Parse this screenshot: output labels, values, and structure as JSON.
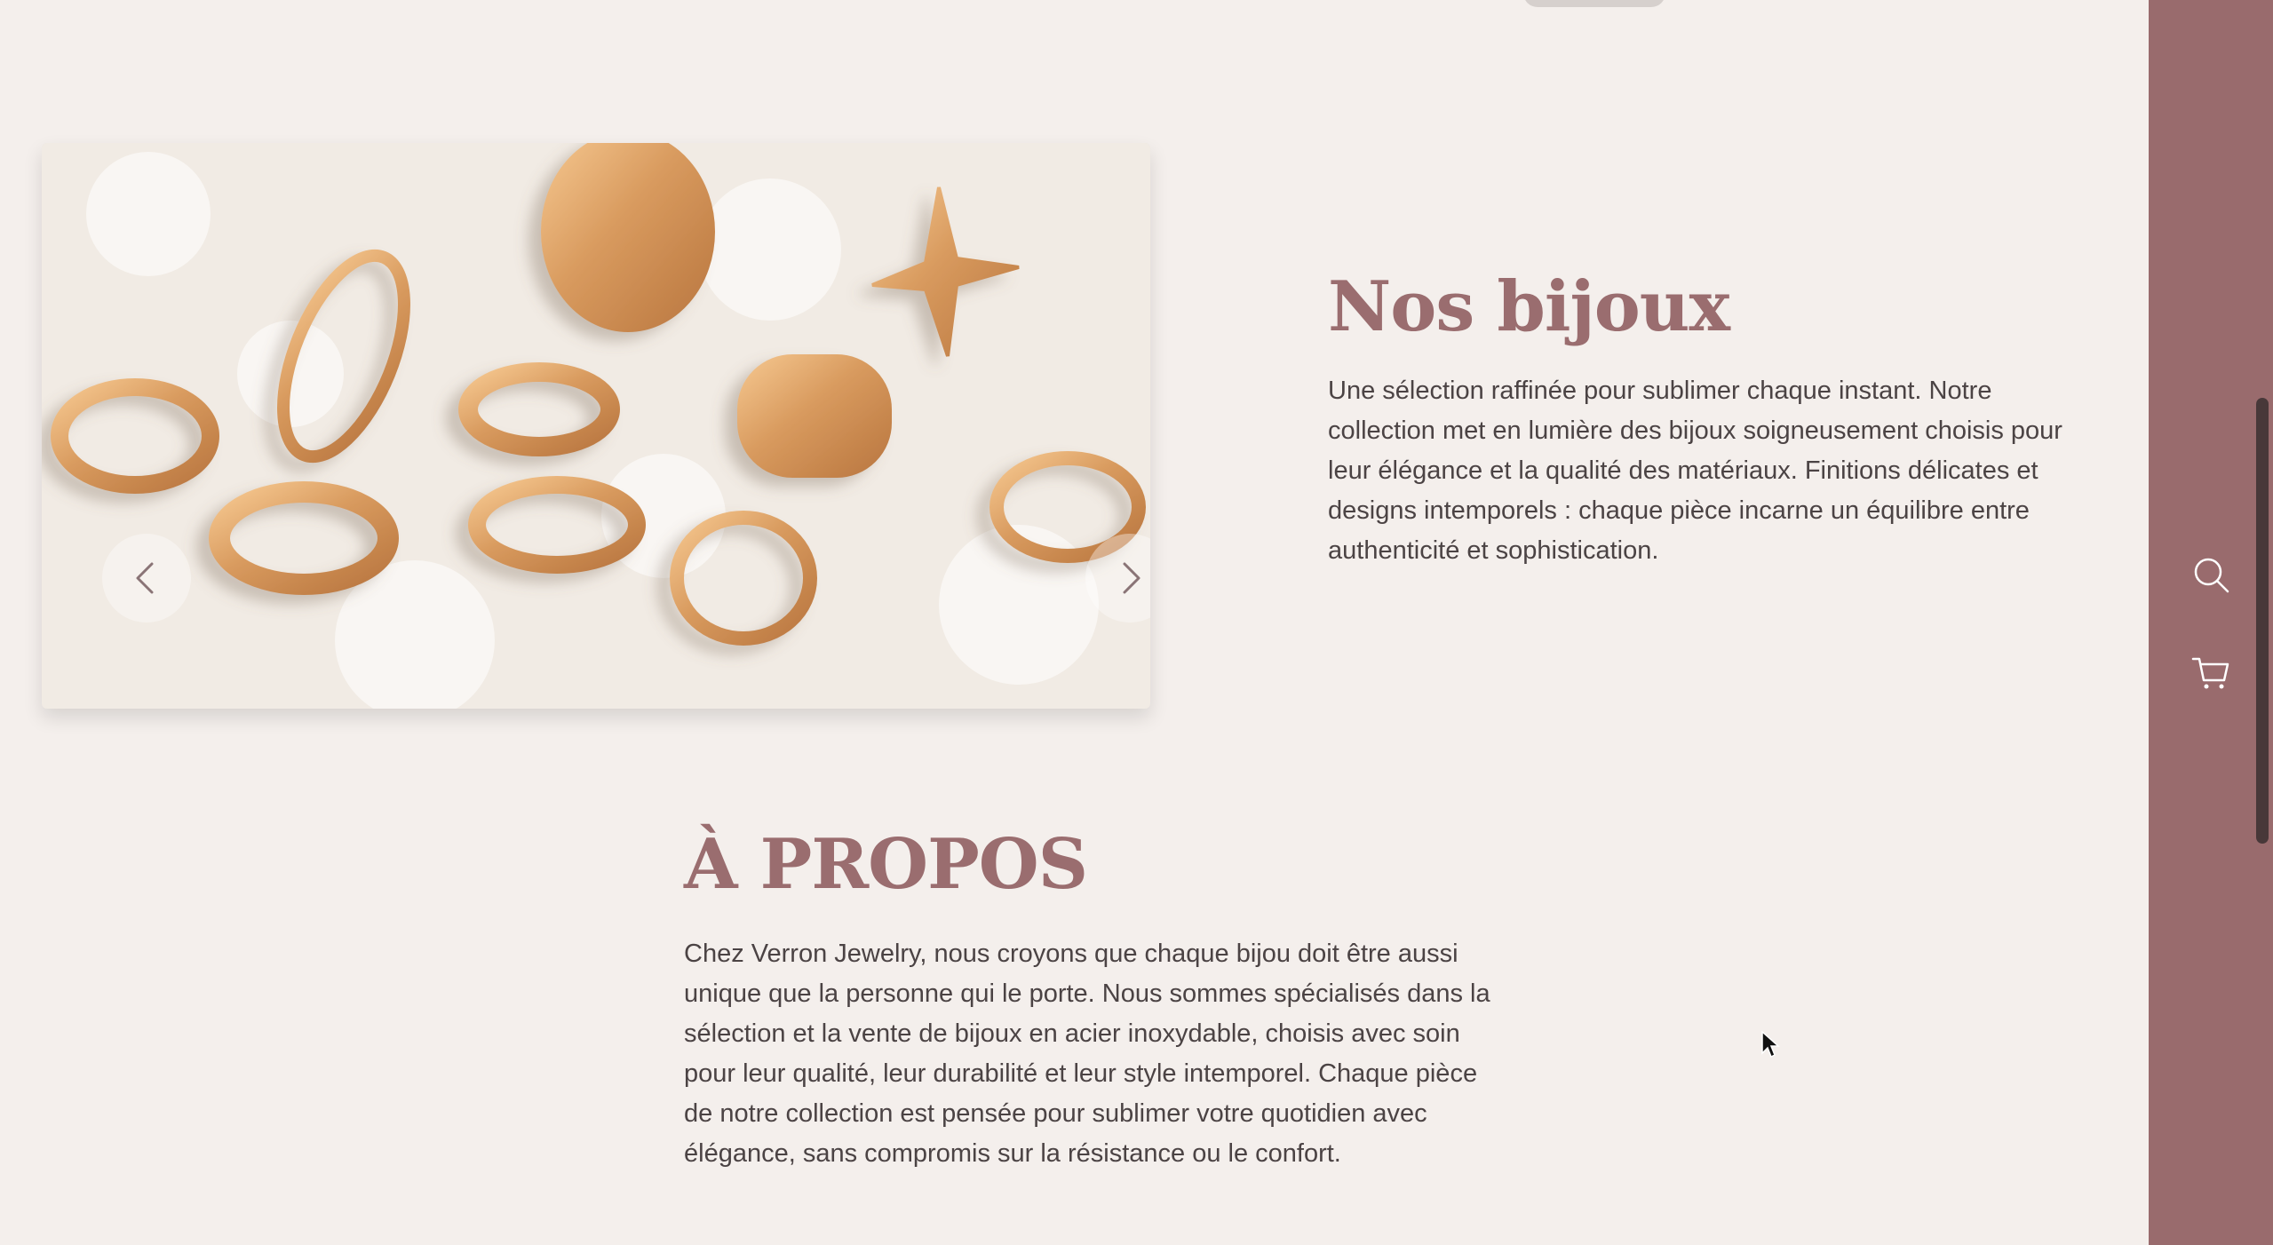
{
  "nos_bijoux": {
    "title": "Nos bijoux",
    "description": "Une sélection raffinée pour sublimer chaque instant. Notre collection met en lumière des bijoux soigneusement choisis pour leur élégance et la qualité des matériaux. Finitions délicates et designs intemporels : chaque pièce incarne un équilibre entre authenticité et sophistication."
  },
  "carousel": {
    "image": "gold-rings-on-white-sand",
    "prev_icon": "chevron-left-icon",
    "next_icon": "chevron-right-icon"
  },
  "a_propos": {
    "title": "À PROPOS",
    "description": "Chez Verron Jewelry, nous croyons que chaque bijou doit être aussi unique que la personne qui le porte. Nous sommes spécialisés dans la sélection et la vente de bijoux en acier inoxydable, choisis avec soin pour leur qualité, leur durabilité et leur style intemporel. Chaque pièce de notre collection est pensée pour sublimer votre quotidien avec élégance, sans compromis sur la résistance ou le confort."
  },
  "sidebar": {
    "icons": [
      "search-icon",
      "cart-icon"
    ]
  },
  "colors": {
    "background": "#f4efec",
    "accent": "#9a6d6f",
    "sidebar": "#996b6d",
    "text": "#4b4344"
  }
}
